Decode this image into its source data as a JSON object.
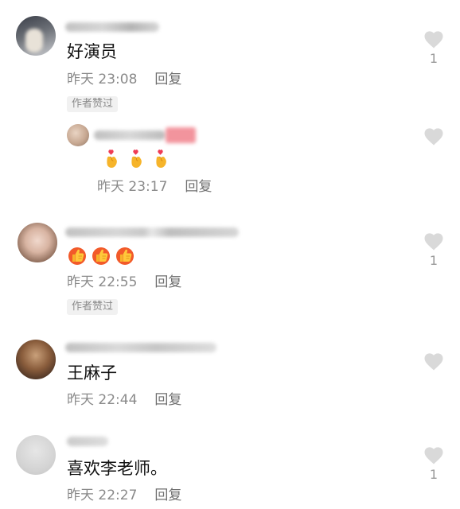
{
  "comments": [
    {
      "text": "好演员",
      "time": "昨天 23:08",
      "reply_label": "回复",
      "badge": "作者赞过",
      "like_count": "1"
    },
    {
      "emoji": [
        "finger-heart-icon",
        "finger-heart-icon",
        "finger-heart-icon"
      ],
      "time": "昨天 23:17",
      "reply_label": "回复"
    },
    {
      "emoji": [
        "thumbs-up-icon",
        "thumbs-up-icon",
        "thumbs-up-icon"
      ],
      "time": "昨天 22:55",
      "reply_label": "回复",
      "badge": "作者赞过",
      "like_count": "1"
    },
    {
      "text": "王麻子",
      "time": "昨天 22:44",
      "reply_label": "回复"
    },
    {
      "text": "喜欢李老师。",
      "time": "昨天 22:27",
      "reply_label": "回复",
      "like_count": "1"
    }
  ],
  "colors": {
    "heart": "#d9d9d9",
    "meta_text": "#8a8a8a",
    "badge_bg": "#f1f1f1"
  }
}
